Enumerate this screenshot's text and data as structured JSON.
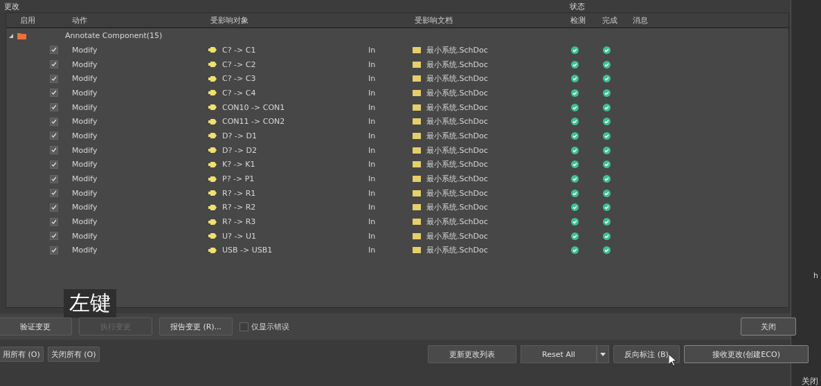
{
  "section_title": "更改",
  "status_group": "状态",
  "columns": {
    "enable": "启用",
    "action": "动作",
    "object": "受影响对象",
    "document": "受影响文档",
    "check": "检测",
    "done": "完成",
    "message": "消息"
  },
  "group": {
    "label": "Annotate Component(15)",
    "expanded": true
  },
  "rows": [
    {
      "enabled": true,
      "action": "Modify",
      "object": "C? -> C1",
      "direction": "In",
      "document": "最小系统.SchDoc",
      "check_ok": true,
      "done_ok": true
    },
    {
      "enabled": true,
      "action": "Modify",
      "object": "C? -> C2",
      "direction": "In",
      "document": "最小系统.SchDoc",
      "check_ok": true,
      "done_ok": true
    },
    {
      "enabled": true,
      "action": "Modify",
      "object": "C? -> C3",
      "direction": "In",
      "document": "最小系统.SchDoc",
      "check_ok": true,
      "done_ok": true
    },
    {
      "enabled": true,
      "action": "Modify",
      "object": "C? -> C4",
      "direction": "In",
      "document": "最小系统.SchDoc",
      "check_ok": true,
      "done_ok": true
    },
    {
      "enabled": true,
      "action": "Modify",
      "object": "CON10 -> CON1",
      "direction": "In",
      "document": "最小系统.SchDoc",
      "check_ok": true,
      "done_ok": true
    },
    {
      "enabled": true,
      "action": "Modify",
      "object": "CON11 -> CON2",
      "direction": "In",
      "document": "最小系统.SchDoc",
      "check_ok": true,
      "done_ok": true
    },
    {
      "enabled": true,
      "action": "Modify",
      "object": "D? -> D1",
      "direction": "In",
      "document": "最小系统.SchDoc",
      "check_ok": true,
      "done_ok": true
    },
    {
      "enabled": true,
      "action": "Modify",
      "object": "D? -> D2",
      "direction": "In",
      "document": "最小系统.SchDoc",
      "check_ok": true,
      "done_ok": true
    },
    {
      "enabled": true,
      "action": "Modify",
      "object": "K? -> K1",
      "direction": "In",
      "document": "最小系统.SchDoc",
      "check_ok": true,
      "done_ok": true
    },
    {
      "enabled": true,
      "action": "Modify",
      "object": "P? -> P1",
      "direction": "In",
      "document": "最小系统.SchDoc",
      "check_ok": true,
      "done_ok": true
    },
    {
      "enabled": true,
      "action": "Modify",
      "object": "R? -> R1",
      "direction": "In",
      "document": "最小系统.SchDoc",
      "check_ok": true,
      "done_ok": true
    },
    {
      "enabled": true,
      "action": "Modify",
      "object": "R? -> R2",
      "direction": "In",
      "document": "最小系统.SchDoc",
      "check_ok": true,
      "done_ok": true
    },
    {
      "enabled": true,
      "action": "Modify",
      "object": "R? -> R3",
      "direction": "In",
      "document": "最小系统.SchDoc",
      "check_ok": true,
      "done_ok": true
    },
    {
      "enabled": true,
      "action": "Modify",
      "object": "U? -> U1",
      "direction": "In",
      "document": "最小系统.SchDoc",
      "check_ok": true,
      "done_ok": true
    },
    {
      "enabled": true,
      "action": "Modify",
      "object": "USB -> USB1",
      "direction": "In",
      "document": "最小系统.SchDoc",
      "check_ok": true,
      "done_ok": true
    }
  ],
  "caption": "左键",
  "actions": [
    {
      "label": "验证变更",
      "disabled": false
    },
    {
      "label": "执行变更",
      "disabled": true
    },
    {
      "label": "报告变更 (R)...",
      "disabled": false
    }
  ],
  "errors_only": {
    "label": "仅显示错误",
    "checked": false
  },
  "close_button": "关闭",
  "side_text": "h",
  "bottom_left": [
    "用所有 (O)",
    "关闭所有 (O)"
  ],
  "update_button": "更新更改列表",
  "reset_button": "Reset All",
  "back_annotate_button": "反向标注 (B)",
  "accept_button": "接收更改(创建ECO)",
  "behind_button": "关闭"
}
